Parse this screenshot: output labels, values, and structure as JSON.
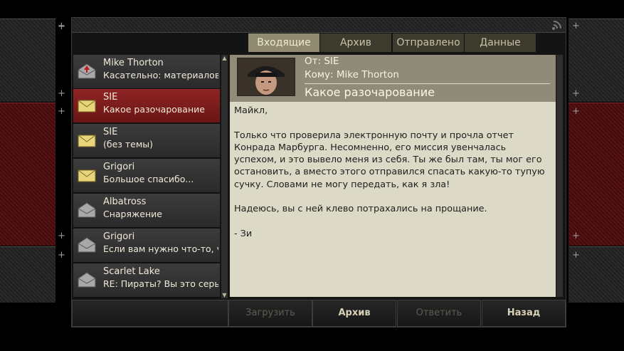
{
  "tabs": [
    {
      "label": "Входящие",
      "active": true
    },
    {
      "label": "Архив",
      "active": false
    },
    {
      "label": "Отправлено",
      "active": false
    },
    {
      "label": "Данные",
      "active": false
    }
  ],
  "messages": [
    {
      "from": "Mike Thorton",
      "subject": "Касательно: материалов ...",
      "icon": "envelope-alert-icon",
      "selected": false
    },
    {
      "from": "SIE",
      "subject": "Какое разочарование",
      "icon": "envelope-icon",
      "selected": true
    },
    {
      "from": "SIE",
      "subject": "(без темы)",
      "icon": "envelope-icon",
      "selected": false
    },
    {
      "from": "Grigori",
      "subject": "Большое спасибо...",
      "icon": "envelope-icon",
      "selected": false
    },
    {
      "from": "Albatross",
      "subject": "Снаряжение",
      "icon": "envelope-open-icon",
      "selected": false
    },
    {
      "from": "Grigori",
      "subject": "Если вам нужно что-то, ч...",
      "icon": "envelope-open-icon",
      "selected": false
    },
    {
      "from": "Scarlet Lake",
      "subject": "RE: Пираты? Вы это серь...",
      "icon": "envelope-open-icon",
      "selected": false
    }
  ],
  "reader": {
    "from": "От: SIE",
    "to": "Кому: Mike Thorton",
    "subject": "Какое разочарование",
    "body": [
      "Майкл,",
      "Только что проверила электронную почту и прочла отчет Конрада Марбурга. Несомненно, его миссия увенчалась успехом, и это вывело меня из себя. Ты же был там, ты мог его остановить, а вместо этого отправился спасать какую-то тупую сучку. Словами не могу передать, как я зла!",
      "Надеюсь, вы с ней клево потрахались на прощание.",
      "- Зи"
    ]
  },
  "buttons": {
    "load": "Загрузить",
    "archive": "Архив",
    "reply": "Ответить",
    "back": "Назад"
  },
  "colors": {
    "selected_row": "#8e2424",
    "active_tab": "#8f8a70",
    "reader_bg": "#dcdac6",
    "header_bg": "#8f8b78"
  }
}
